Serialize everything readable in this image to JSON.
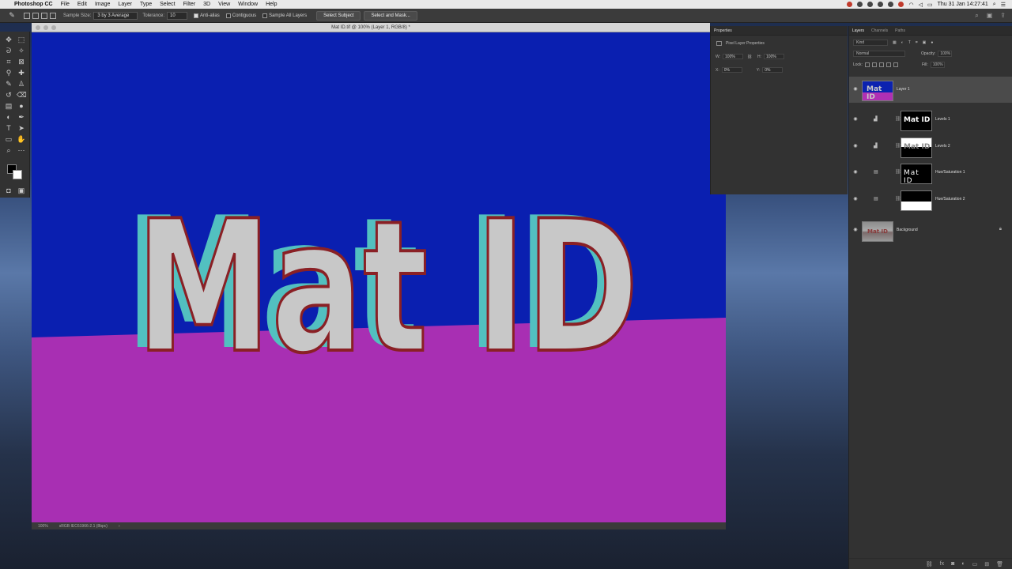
{
  "menubar": {
    "app_name": "Photoshop CC",
    "items": [
      "File",
      "Edit",
      "Image",
      "Layer",
      "Type",
      "Select",
      "Filter",
      "3D",
      "View",
      "Window",
      "Help"
    ],
    "clock": "Thu 31 Jan  14:27:41"
  },
  "options_bar": {
    "sample_size_label": "Sample Size:",
    "sample_size_value": "3 by 3 Average",
    "tolerance_label": "Tolerance:",
    "tolerance_value": "10",
    "anti_alias": "Anti-alias",
    "contiguous": "Contiguous",
    "sample_all_layers": "Sample All Layers",
    "select_subject": "Select Subject",
    "select_and_mask": "Select and Mask..."
  },
  "document": {
    "title": "Mat ID.tif @ 100% (Layer 1, RGB/8) *",
    "canvas_text": "Mat ID",
    "zoom": "100%",
    "profile": "sRGB IEC61966-2.1 (8bpc)",
    "colors": {
      "sky": "#0a1fb0",
      "floor": "#a82fb3",
      "face": "#c8c8c8",
      "extrude": "#52c0c0",
      "outline": "#8a2025"
    }
  },
  "properties": {
    "tab": "Properties",
    "subtitle": "Pixel Layer Properties",
    "w_label": "W:",
    "w_value": "100%",
    "h_label": "H:",
    "h_value": "100%",
    "x_label": "X:",
    "x_value": "0%",
    "y_label": "Y:",
    "y_value": "0%"
  },
  "layers_panel": {
    "tabs": [
      "Layers",
      "Channels",
      "Paths"
    ],
    "kind": "Kind",
    "blend_mode": "Normal",
    "opacity_label": "Opacity:",
    "opacity_value": "100%",
    "lock_label": "Lock:",
    "fill_label": "Fill:",
    "fill_value": "100%",
    "layers": [
      {
        "name": "Layer 1",
        "selected": true,
        "thumb_text": "Mat ID"
      },
      {
        "name": "Levels 1",
        "mask_text": "Mat ID"
      },
      {
        "name": "Levels 2",
        "mask_text": "Mat ID"
      },
      {
        "name": "Hue/Saturation 1",
        "mask_text": "Mat ID"
      },
      {
        "name": "Hue/Saturation 2"
      },
      {
        "name": "Background",
        "thumb_text": "Mat ID"
      }
    ]
  }
}
